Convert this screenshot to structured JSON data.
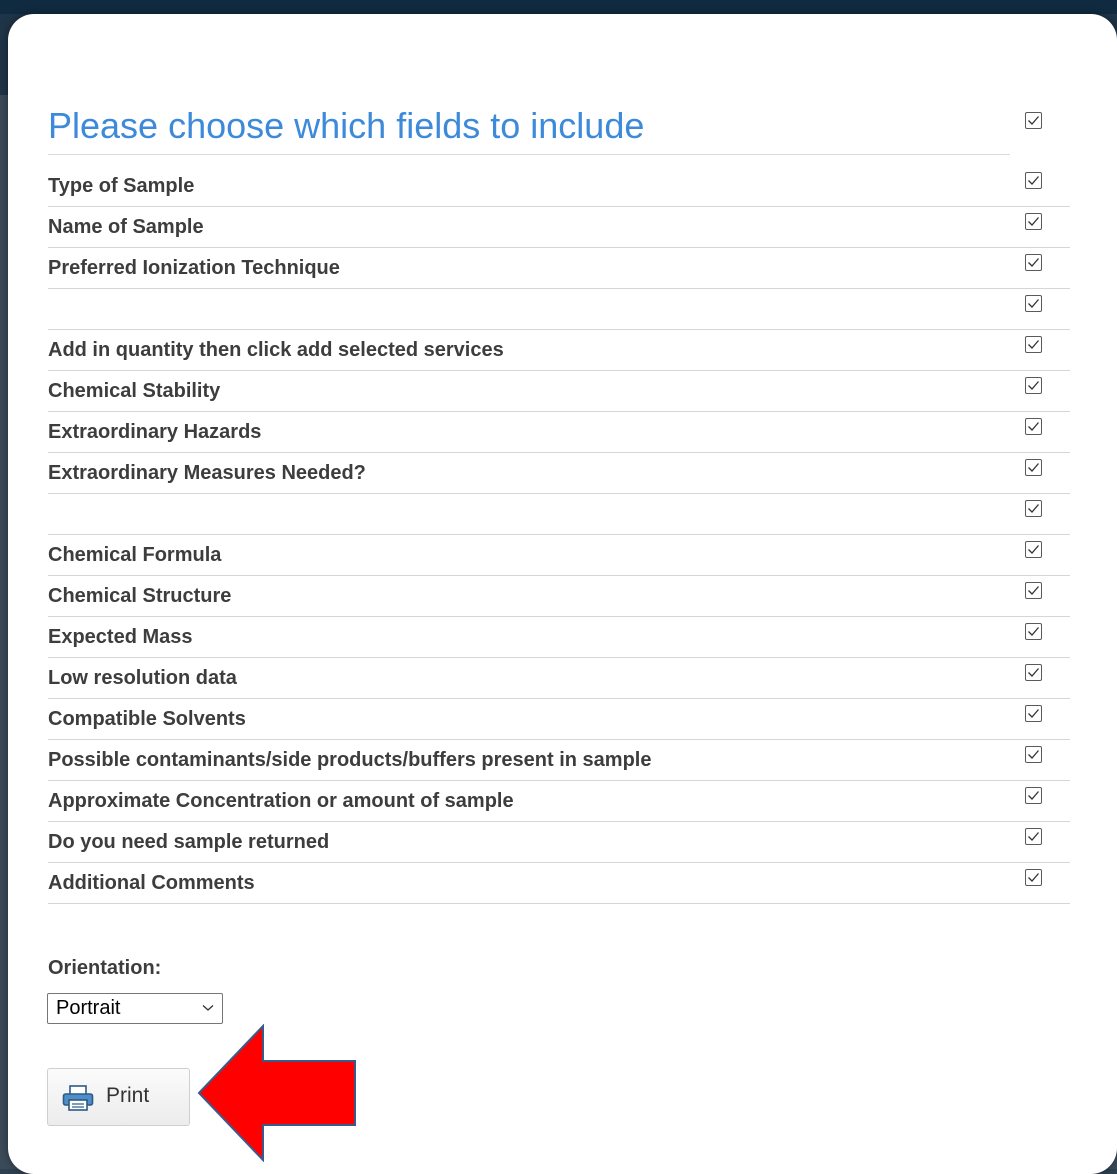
{
  "dialog": {
    "title": "Please choose which fields to include",
    "select_all_checked": true
  },
  "fields": [
    {
      "label": "Type of Sample",
      "checked": true
    },
    {
      "label": "Name of Sample",
      "checked": true
    },
    {
      "label": "Preferred Ionization Technique",
      "checked": true
    },
    {
      "label": "",
      "checked": true
    },
    {
      "label": "Add in quantity then click add selected services",
      "checked": true
    },
    {
      "label": "Chemical Stability",
      "checked": true
    },
    {
      "label": "Extraordinary Hazards",
      "checked": true
    },
    {
      "label": "Extraordinary Measures Needed?",
      "checked": true
    },
    {
      "label": "",
      "checked": true
    },
    {
      "label": "Chemical Formula",
      "checked": true
    },
    {
      "label": "Chemical Structure",
      "checked": true
    },
    {
      "label": "Expected Mass",
      "checked": true
    },
    {
      "label": "Low resolution data",
      "checked": true
    },
    {
      "label": "Compatible Solvents",
      "checked": true
    },
    {
      "label": "Possible contaminants/side products/buffers present in sample",
      "checked": true
    },
    {
      "label": "Approximate Concentration or amount of sample",
      "checked": true
    },
    {
      "label": "Do you need sample returned",
      "checked": true
    },
    {
      "label": "Additional Comments",
      "checked": true
    }
  ],
  "orientation": {
    "label": "Orientation:",
    "selected": "Portrait"
  },
  "print_button": {
    "label": "Print",
    "icon": "printer-icon"
  },
  "annotation": {
    "icon": "red-arrow-left-icon",
    "color": "#ff0000"
  },
  "colors": {
    "title": "#3c8ad9",
    "arrow_fill": "#ff0000",
    "arrow_stroke": "#3a5a8c"
  }
}
